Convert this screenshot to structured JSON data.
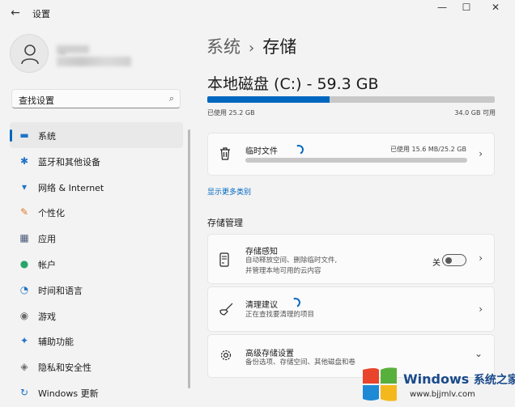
{
  "window": {
    "title": "设置",
    "back_glyph": "←",
    "min_glyph": "—",
    "max_glyph": "☐",
    "close_glyph": "✕"
  },
  "profile": {
    "name": "铭"
  },
  "search": {
    "placeholder": "查找设置",
    "icon": "search-icon"
  },
  "sidebar": {
    "items": [
      {
        "label": "系统",
        "icon": "system-icon",
        "glyph": "▬",
        "color": "#1f73c8",
        "active": true
      },
      {
        "label": "蓝牙和其他设备",
        "icon": "bluetooth-icon",
        "glyph": "✱",
        "color": "#1f73c8"
      },
      {
        "label": "网络 & Internet",
        "icon": "wifi-icon",
        "glyph": "▾",
        "color": "#1f73c8"
      },
      {
        "label": "个性化",
        "icon": "brush-icon",
        "glyph": "✎",
        "color": "#e07a2a"
      },
      {
        "label": "应用",
        "icon": "apps-icon",
        "glyph": "▦",
        "color": "#4a5a7a"
      },
      {
        "label": "帐户",
        "icon": "account-icon",
        "glyph": "●",
        "color": "#2aa56a"
      },
      {
        "label": "时间和语言",
        "icon": "globe-clock-icon",
        "glyph": "◔",
        "color": "#1f73c8"
      },
      {
        "label": "游戏",
        "icon": "gamepad-icon",
        "glyph": "◉",
        "color": "#6a6a6a"
      },
      {
        "label": "辅助功能",
        "icon": "accessibility-icon",
        "glyph": "✦",
        "color": "#1f73c8"
      },
      {
        "label": "隐私和安全性",
        "icon": "shield-icon",
        "glyph": "◈",
        "color": "#6a6a6a"
      },
      {
        "label": "Windows 更新",
        "icon": "update-icon",
        "glyph": "↻",
        "color": "#1f73c8"
      }
    ]
  },
  "main": {
    "breadcrumb_parent": "系统",
    "breadcrumb_sep": "›",
    "breadcrumb_current": "存储",
    "disk_title": "本地磁盘 (C:) - 59.3 GB",
    "used_text": "已使用 25.2 GB",
    "available_text": "34.0 GB 可用",
    "used_fraction": 0.425,
    "temp_files": {
      "title": "临时文件",
      "usage": "已使用 15.6 MB/25.2 GB",
      "icon": "trash-icon"
    },
    "show_more": "显示更多类别",
    "section_title": "存储管理",
    "storage_sense": {
      "title": "存储感知",
      "desc_line1": "自动释放空间、删除临时文件,",
      "desc_line2": "并管理本地可用的云内容",
      "toggle_label": "关",
      "toggle_on": false,
      "icon": "storage-drive-icon"
    },
    "cleanup": {
      "title": "清理建议",
      "desc": "正在查找要清理的项目",
      "icon": "broom-icon"
    },
    "advanced": {
      "title": "高级存储设置",
      "desc": "备份选项、存储空间、其他磁盘和卷",
      "icon": "gear-icon"
    },
    "chevron_right": "›",
    "chevron_down": "⌄"
  },
  "watermark": {
    "brand": "Windows",
    "brand_cn": "系统之家",
    "url": "www.bjjmlv.com"
  }
}
